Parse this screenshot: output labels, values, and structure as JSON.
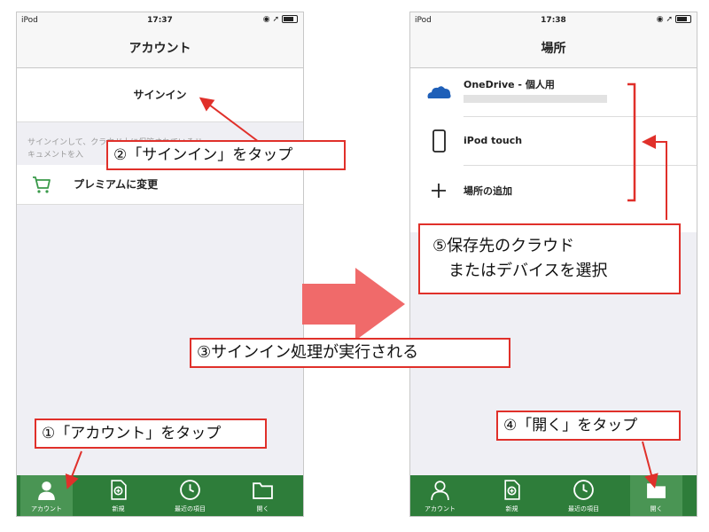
{
  "left_screen": {
    "status": {
      "carrier": "iPod",
      "time": "17:37"
    },
    "title": "アカウント",
    "signin_label": "サインイン",
    "description": [
      "サインインして、クラウド上に保管されているド",
      "キュメントを入"
    ],
    "premium_label": "プレミアムに変更"
  },
  "right_screen": {
    "status": {
      "carrier": "iPod",
      "time": "17:38"
    },
    "title": "場所",
    "locations": [
      {
        "label": "OneDrive - 個人用",
        "icon": "cloud-icon"
      },
      {
        "label": "iPod touch",
        "icon": "phone-device-icon"
      },
      {
        "label": "場所の追加",
        "icon": "plus-icon"
      }
    ]
  },
  "tabbar": {
    "tabs": [
      {
        "label": "アカウント",
        "icon": "person-icon"
      },
      {
        "label": "新規",
        "icon": "new-document-icon"
      },
      {
        "label": "最近の項目",
        "icon": "clock-icon"
      },
      {
        "label": "開く",
        "icon": "folder-icon"
      }
    ],
    "left_active": 0,
    "right_active": 3
  },
  "annotations": {
    "step1": "①「アカウント」をタップ",
    "step2": "②「サインイン」をタップ",
    "step3": "③サインイン処理が実行される",
    "step4": "④「開く」をタップ",
    "step5_line1": "⑤保存先のクラウド",
    "step5_line2": "　またはデバイスを選択"
  },
  "colors": {
    "tabbar_green": "#2e7d3a",
    "tabbar_active": "#4a9554",
    "callout_red": "#e0302a",
    "arrow_pink": "#f06a6a",
    "onedrive_blue": "#1e5fb8"
  }
}
